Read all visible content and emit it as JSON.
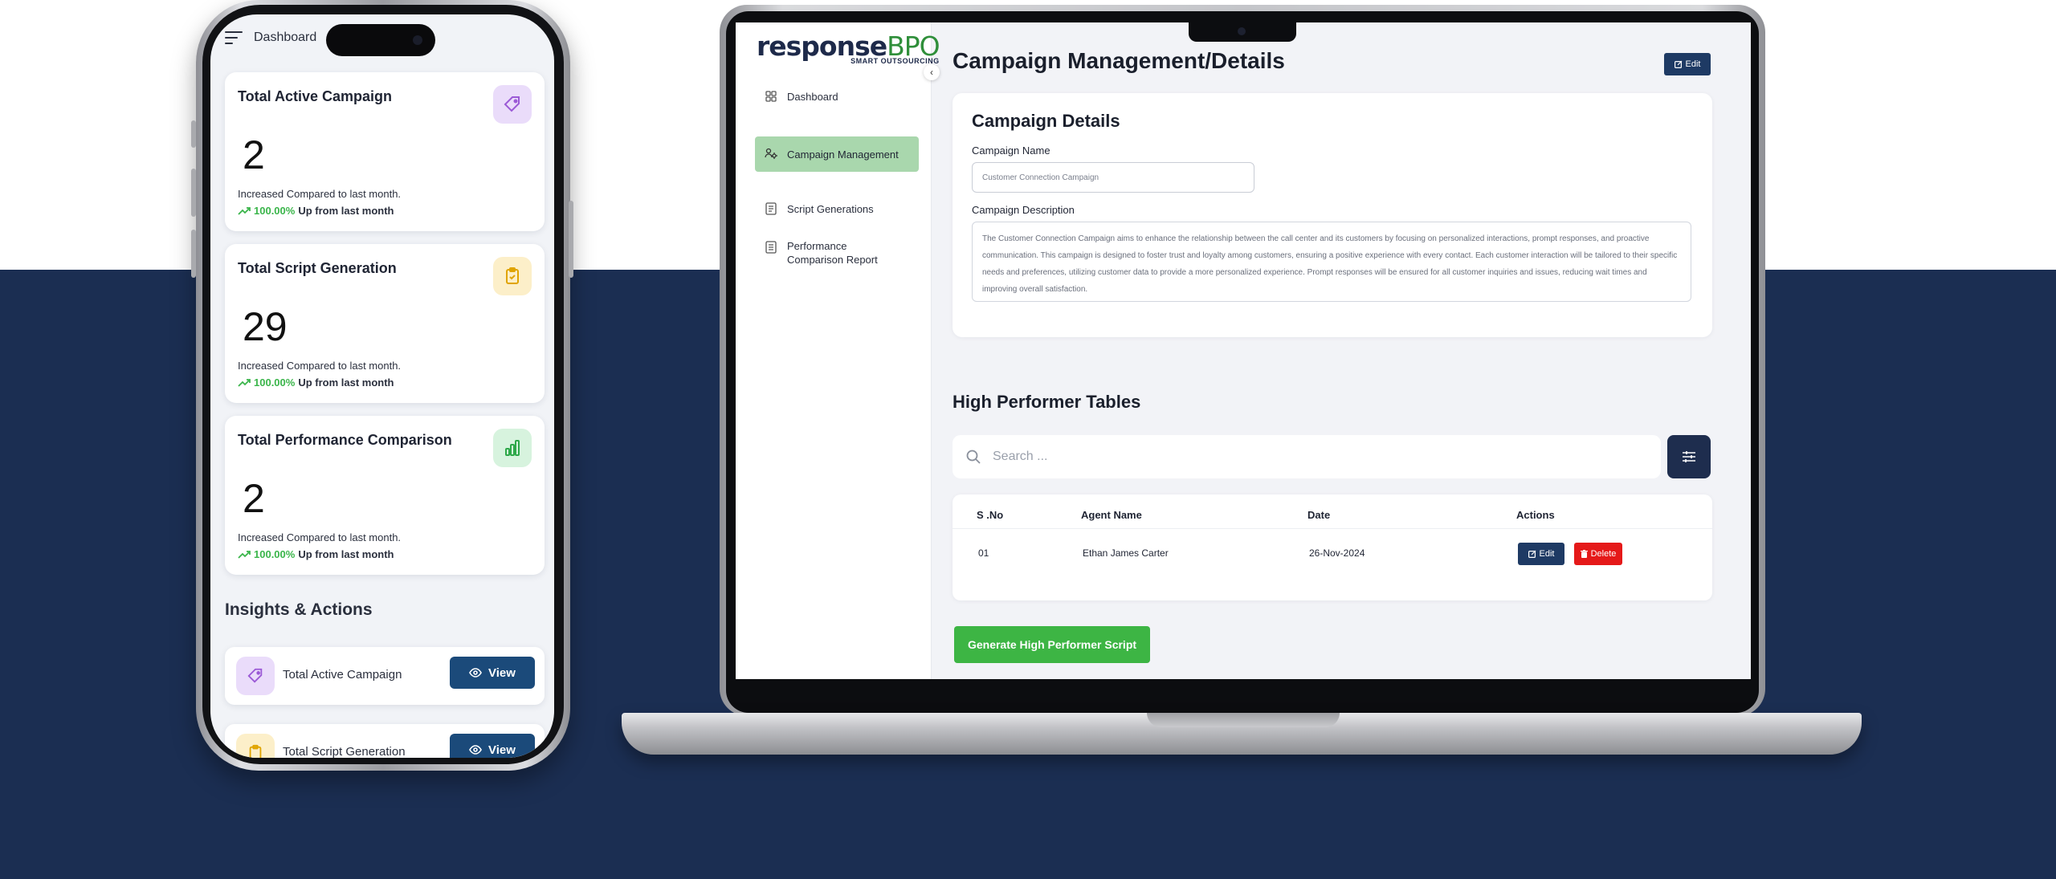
{
  "phone": {
    "header_title": "Dashboard",
    "stats": [
      {
        "title": "Total Active Campaign",
        "value": "2",
        "note": "Increased Compared to last month.",
        "pct": "100.00%",
        "trend_text": "Up from last month",
        "icon": "tag-icon",
        "icon_color": "#9b59d6",
        "icon_bg": "#eadcfa"
      },
      {
        "title": "Total Script Generation",
        "value": "29",
        "note": "Increased Compared to last month.",
        "pct": "100.00%",
        "trend_text": "Up from last month",
        "icon": "clipboard-icon",
        "icon_color": "#e0a400",
        "icon_bg": "#fcefc9"
      },
      {
        "title": "Total Performance Comparison",
        "value": "2",
        "note": "Increased Compared to last month.",
        "pct": "100.00%",
        "trend_text": "Up from last month",
        "icon": "bar-chart-icon",
        "icon_color": "#2ea84a",
        "icon_bg": "#d7f3de"
      }
    ],
    "insights_title": "Insights & Actions",
    "insights": [
      {
        "label": "Total Active Campaign",
        "button": "View",
        "icon": "tag-icon"
      },
      {
        "label": "Total Script Generation",
        "button": "View",
        "icon": "clipboard-icon"
      }
    ]
  },
  "laptop": {
    "brand": {
      "main": "response",
      "accent": "BPO",
      "tagline": "SMART OUTSOURCING"
    },
    "nav": [
      {
        "label": "Dashboard",
        "icon": "grid-icon",
        "active": false
      },
      {
        "label": "Campaign Management",
        "icon": "campaign-icon",
        "active": true
      },
      {
        "label": "Script Generations",
        "icon": "document-icon",
        "active": false
      },
      {
        "label": "Performance Comparison Report",
        "icon": "report-icon",
        "active": false
      }
    ],
    "page_title": "Campaign Management/Details",
    "edit_label": "Edit",
    "details": {
      "title": "Campaign Details",
      "name_label": "Campaign Name",
      "name_value": "Customer Connection Campaign",
      "desc_label": "Campaign Description",
      "desc_value": "The Customer Connection Campaign aims to enhance the relationship between the call center and its customers by focusing on personalized interactions, prompt responses, and proactive communication. This campaign is designed to foster trust and loyalty among customers, ensuring a positive experience with every contact. Each customer interaction will be tailored to their specific needs and preferences, utilizing customer data to provide a more personalized experience. Prompt responses will be ensured for all customer inquiries and issues, reducing wait times and improving overall satisfaction."
    },
    "high_performer": {
      "title": "High Performer Tables",
      "search_placeholder": "Search ...",
      "columns": [
        "S .No",
        "Agent Name",
        "Date",
        "Actions"
      ],
      "rows": [
        {
          "sno": "01",
          "agent": "Ethan James Carter",
          "date": "26-Nov-2024",
          "edit": "Edit",
          "delete": "Delete"
        }
      ]
    },
    "generate_button": "Generate High Performer Script"
  },
  "colors": {
    "navy": "#1b2e52",
    "accent_green": "#3db544",
    "active_nav": "#a9d7ad",
    "delete_red": "#e51919",
    "button_blue": "#1e3a64"
  }
}
